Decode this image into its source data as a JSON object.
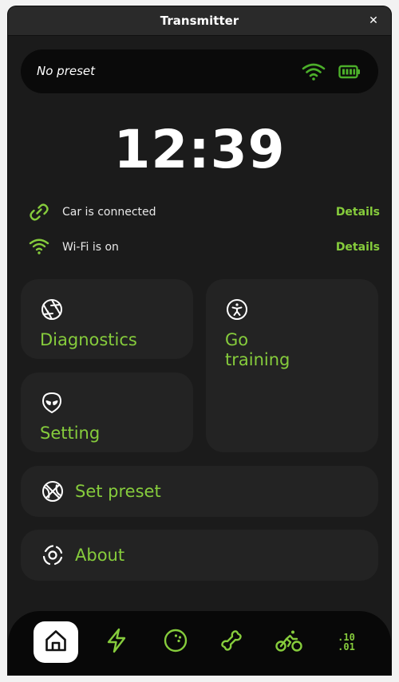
{
  "window": {
    "title": "Transmitter",
    "close_glyph": "✕"
  },
  "status": {
    "preset_label": "No preset",
    "wifi_icon": "wifi-icon",
    "battery_icon": "battery-icon"
  },
  "clock": {
    "time": "12:39"
  },
  "connections": [
    {
      "icon": "link-icon",
      "text": "Car is connected",
      "action": "Details"
    },
    {
      "icon": "wifi-icon",
      "text": "Wi-Fi is on",
      "action": "Details"
    }
  ],
  "cards": {
    "diagnostics": {
      "icon": "aperture-icon",
      "label": "Diagnostics"
    },
    "training": {
      "icon": "accessibility-icon",
      "label_line1": "Go",
      "label_line2": "training"
    },
    "setting": {
      "icon": "alien-icon",
      "label": "Setting"
    },
    "set_preset": {
      "icon": "basketball-icon",
      "label": "Set preset"
    },
    "about": {
      "icon": "disc-icon",
      "label": "About"
    }
  },
  "bottom_nav": {
    "items": [
      "home-icon",
      "lightning-icon",
      "bowling-ball-icon",
      "bone-icon",
      "bicycle-icon",
      "binary-icon"
    ],
    "active": "home-icon",
    "binary_top": ".10",
    "binary_bottom": ".01"
  },
  "colors": {
    "accent": "#86cc3c",
    "background": "#1b1b1b",
    "card": "#232323",
    "text": "#ffffff"
  }
}
